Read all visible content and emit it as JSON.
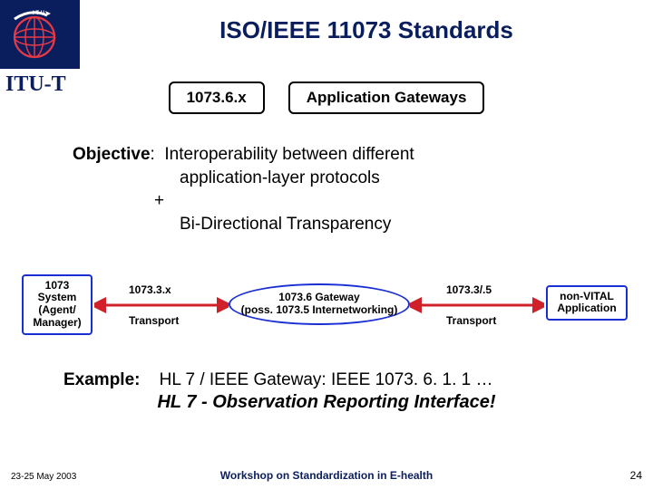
{
  "header": {
    "title": "ISO/IEEE 11073 Standards",
    "itu_t": "ITU-T"
  },
  "row1": {
    "left": "1073.6.x",
    "right": "Application Gateways"
  },
  "objective": {
    "label": "Objective",
    "text1": "Interoperability between different",
    "text2": "application-layer protocols",
    "plus": "+",
    "text3": "Bi-Directional Transparency"
  },
  "diagram": {
    "left_box": "1073\nSystem\n(Agent/\nManager)",
    "arrow1_top": "1073.3.x",
    "arrow1_bottom": "Transport",
    "center": "1073.6 Gateway\n(poss. 1073.5 Internetworking)",
    "arrow2_top": "1073.3/.5",
    "arrow2_bottom": "Transport",
    "right_box": "non-VITAL\nApplication"
  },
  "example": {
    "label": "Example:",
    "text1": "HL 7 / IEEE Gateway: IEEE 1073. 6. 1. 1 …",
    "text2": "HL 7 - Observation Reporting Interface!"
  },
  "footer": {
    "date": "23-25 May 2003",
    "center": "Workshop on Standardization in E-health",
    "page": "24"
  }
}
